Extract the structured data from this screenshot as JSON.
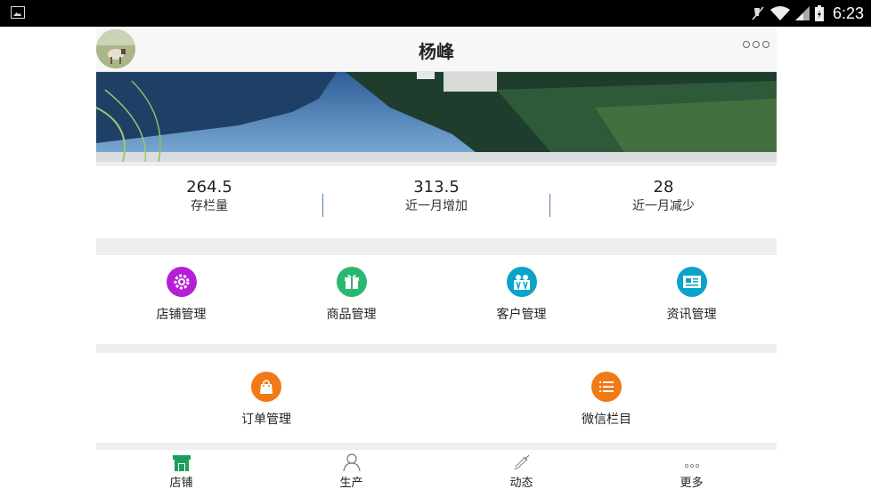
{
  "status_bar": {
    "time": "6:23"
  },
  "header": {
    "title": "杨峰"
  },
  "stats": [
    {
      "value": "264.5",
      "label": "存栏量"
    },
    {
      "value": "313.5",
      "label": "近一月增加"
    },
    {
      "value": "28",
      "label": "近一月减少"
    }
  ],
  "menu_row1": [
    {
      "label": "店铺管理",
      "icon": "gear-icon",
      "color": "#b51fd6"
    },
    {
      "label": "商品管理",
      "icon": "gift-icon",
      "color": "#29b870"
    },
    {
      "label": "客户管理",
      "icon": "customers-icon",
      "color": "#0aa3c9"
    },
    {
      "label": "资讯管理",
      "icon": "newspaper-icon",
      "color": "#0aa3c9"
    }
  ],
  "menu_row2": [
    {
      "label": "订单管理",
      "icon": "shopping-bag-icon",
      "color": "#f07a16"
    },
    {
      "label": "微信栏目",
      "icon": "list-icon",
      "color": "#f07a16"
    }
  ],
  "tabs": [
    {
      "label": "店铺",
      "icon": "store-icon",
      "active": true
    },
    {
      "label": "生产",
      "icon": "person-icon"
    },
    {
      "label": "动态",
      "icon": "syringe-icon"
    },
    {
      "label": "更多",
      "icon": "more-dots-icon"
    }
  ],
  "colors": {
    "accent_green": "#1aa05a"
  }
}
